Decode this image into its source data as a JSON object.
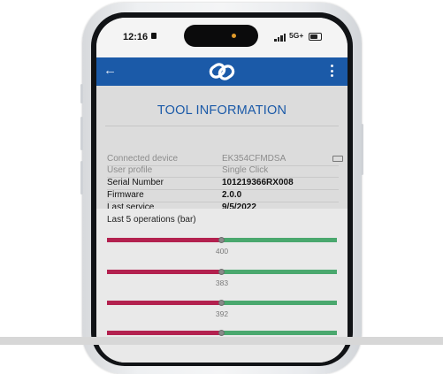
{
  "status_bar": {
    "time": "12:16",
    "network": "5G+"
  },
  "app_bar": {
    "back_icon": "arrow-left-icon",
    "logo_icon": "link-logo-icon",
    "menu_icon": "more-vert-icon"
  },
  "tool_info": {
    "title": "TOOL INFORMATION",
    "rows": [
      {
        "label": "Connected device",
        "value": "EK354CFMDSA"
      },
      {
        "label": "User profile",
        "value": "Single Click"
      },
      {
        "label": "Serial Number",
        "value": "101219366RX008"
      },
      {
        "label": "Firmware",
        "value": "2.0.0"
      },
      {
        "label": "Last service",
        "value": "9/5/2022"
      }
    ]
  },
  "operations": {
    "title": "Last 5 operations  (bar)",
    "values": [
      "400",
      "383",
      "392"
    ]
  },
  "colors": {
    "brand_blue": "#1b5aa8",
    "low_range": "#b3214f",
    "ok_range": "#4aa86e"
  }
}
